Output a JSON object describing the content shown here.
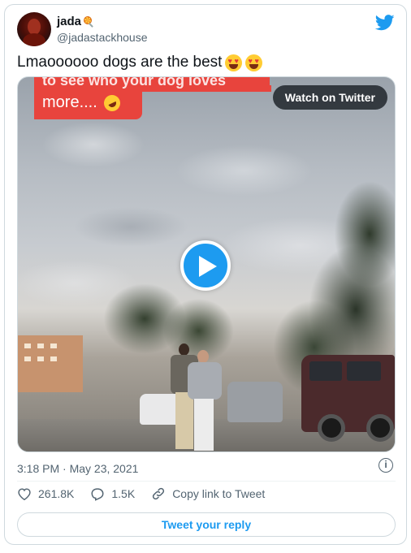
{
  "author": {
    "display_name": "jada",
    "name_emoji": "lollipop-emoji",
    "handle": "@jadastackhouse",
    "avatar": "avatar-photo"
  },
  "brand": {
    "icon": "twitter-bird-icon",
    "color": "#1d9bf0"
  },
  "tweet": {
    "text": "Lmaoooooo dogs are the best",
    "emojis": [
      "heart-eyes-emoji",
      "heart-eyes-emoji"
    ]
  },
  "media": {
    "caption_top": "to see who your dog loves",
    "caption_text": "more....",
    "caption_emoji": "rofl-emoji",
    "caption_color": "#e8443d",
    "watch_label": "Watch on Twitter",
    "play_icon": "play-icon",
    "play_color": "#1d9bf0"
  },
  "meta": {
    "timestamp": "3:18 PM · May 23, 2021",
    "info_icon": "info-icon"
  },
  "actions": {
    "likes": "261.8K",
    "replies": "1.5K",
    "copy_link": "Copy link to Tweet"
  },
  "reply": {
    "label": "Tweet your reply"
  },
  "colors": {
    "text": "#0f1419",
    "secondary": "#536471",
    "accent": "#1d9bf0",
    "border": "#cfd9de"
  }
}
